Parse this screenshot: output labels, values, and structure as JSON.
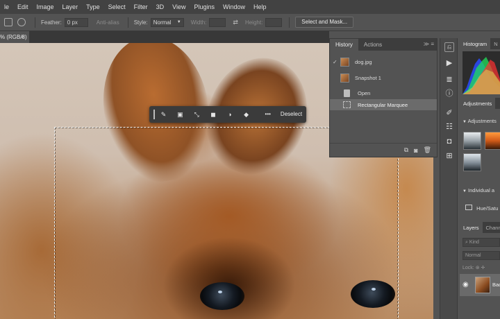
{
  "menubar": {
    "items": [
      "le",
      "Edit",
      "Image",
      "Layer",
      "Type",
      "Select",
      "Filter",
      "3D",
      "View",
      "Plugins",
      "Window",
      "Help"
    ]
  },
  "options": {
    "feather_label": "Feather:",
    "feather_value": "0 px",
    "antialias_label": "Anti-alias",
    "style_label": "Style:",
    "style_value": "Normal",
    "width_label": "Width:",
    "height_label": "Height:",
    "select_mask_button": "Select and Mask..."
  },
  "document": {
    "tab_label": "% (RGB/8)",
    "tab_close": "×"
  },
  "taskbar": {
    "more_label": "•••",
    "deselect_label": "Deselect"
  },
  "history": {
    "tab_active": "History",
    "tab_inactive": "Actions",
    "menu_label": "≫ ≡",
    "items": [
      {
        "label": "dog.jpg",
        "kind": "snapshot"
      },
      {
        "label": "Snapshot 1",
        "kind": "snapshot"
      },
      {
        "label": "Open",
        "kind": "open"
      },
      {
        "label": "Rectangular Marquee",
        "kind": "marquee"
      }
    ]
  },
  "right_panels": {
    "histogram_tab": "Histogram",
    "navigator_tab": "N",
    "adjustments_tab": "Adjustments",
    "adjustments_header": "Adjustments",
    "individual_header": "Individual a",
    "hue_label": "Hue/Satu",
    "layers_tab": "Layers",
    "channels_tab": "Chann",
    "kind_placeholder": "Kind",
    "blend_mode": "Normal",
    "lock_label": "Lock:",
    "layer_name": "Backg"
  },
  "colors": {
    "accent": "#1473e6",
    "panel_bg": "#535353",
    "menu_bg": "#424242"
  }
}
